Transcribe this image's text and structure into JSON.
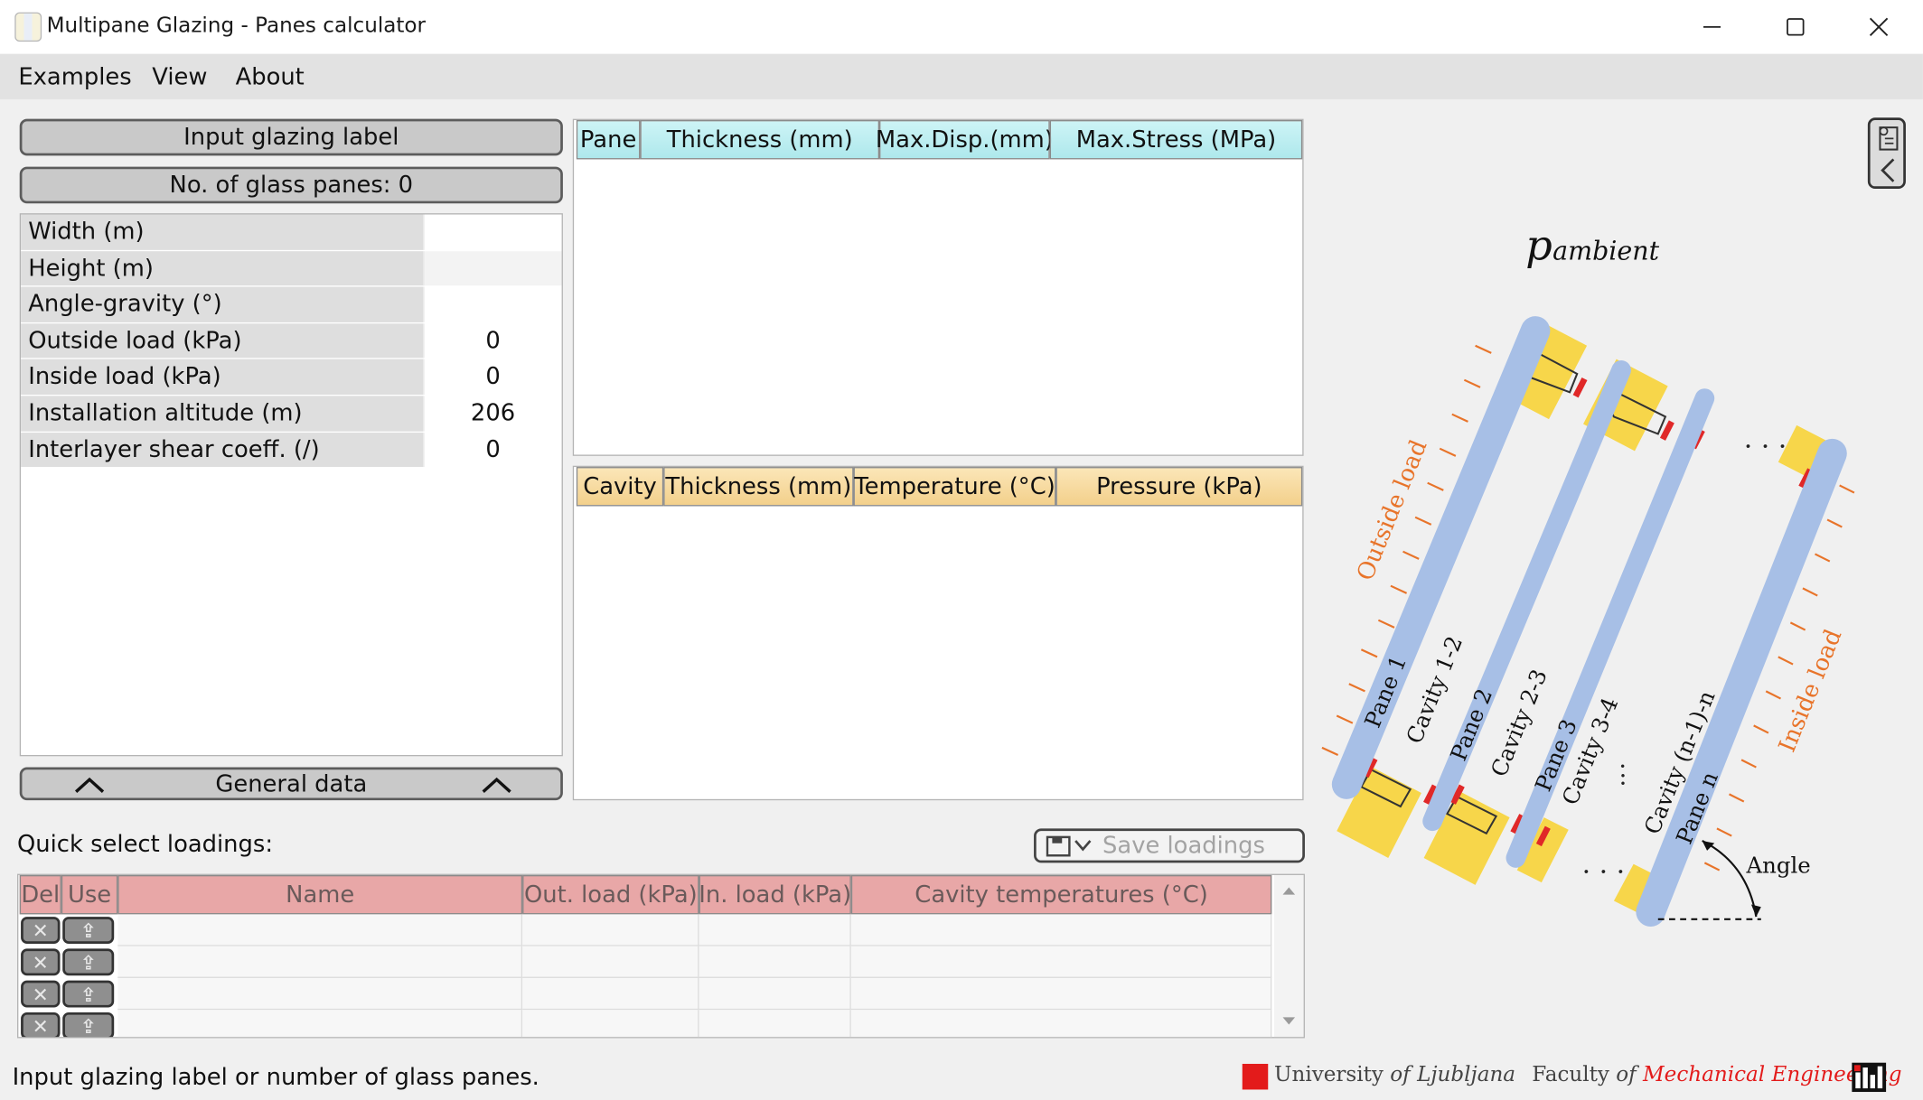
{
  "window": {
    "title": "Multipane Glazing - Panes calculator",
    "minimize": "—",
    "maximize": "☐",
    "close": "✕"
  },
  "menu": {
    "items": [
      "Examples",
      "View",
      "About"
    ]
  },
  "left": {
    "label_button": "Input glazing label",
    "panes_button": "No. of glass panes: 0",
    "properties": [
      {
        "label": "Width (m)",
        "value": ""
      },
      {
        "label": "Height (m)",
        "value": ""
      },
      {
        "label": "Angle-gravity (°)",
        "value": ""
      },
      {
        "label": "Outside load (kPa)",
        "value": "0"
      },
      {
        "label": "Inside load (kPa)",
        "value": "0"
      },
      {
        "label": "Installation altitude (m)",
        "value": "206"
      },
      {
        "label": "Interlayer shear coeff. (/)",
        "value": "0"
      }
    ],
    "general_data": "General data"
  },
  "panes_table": {
    "headers": [
      "Pane",
      "Thickness (mm)",
      "Max.Disp.(mm)",
      "Max.Stress (MPa)"
    ]
  },
  "cavity_table": {
    "headers": [
      "Cavity",
      "Thickness (mm)",
      "Temperature (°C)",
      "Pressure (kPa)"
    ]
  },
  "loadings": {
    "title": "Quick select loadings:",
    "save_label": "Save loadings",
    "headers": [
      "Del",
      "Use",
      "Name",
      "Out. load (kPa)",
      "In. load (kPa)",
      "Cavity temperatures (°C)"
    ],
    "row_count": 4
  },
  "diagram": {
    "p_symbol": "p",
    "p_subscript": "ambient",
    "outside_load": "Outside load",
    "inside_load": "Inside load",
    "panes": [
      "Pane 1",
      "Pane 2",
      "Pane 3",
      "Pane n"
    ],
    "cavities": [
      "Cavity 1-2",
      "Cavity 2-3",
      "Cavity 3-4",
      "Cavity (n-1)-n"
    ],
    "angle": "Angle",
    "colors": {
      "glass": "#a7bfe6",
      "spacer": "#f7d64a",
      "seal": "#e02828",
      "load": "#e8742a"
    }
  },
  "status": {
    "message": "Input glazing label or number of glass panes.",
    "university": "University",
    "of1": "of",
    "ljubljana": "Ljubljana",
    "faculty": "Faculty",
    "of2": "of",
    "mech": "Mechanical Engineering"
  }
}
